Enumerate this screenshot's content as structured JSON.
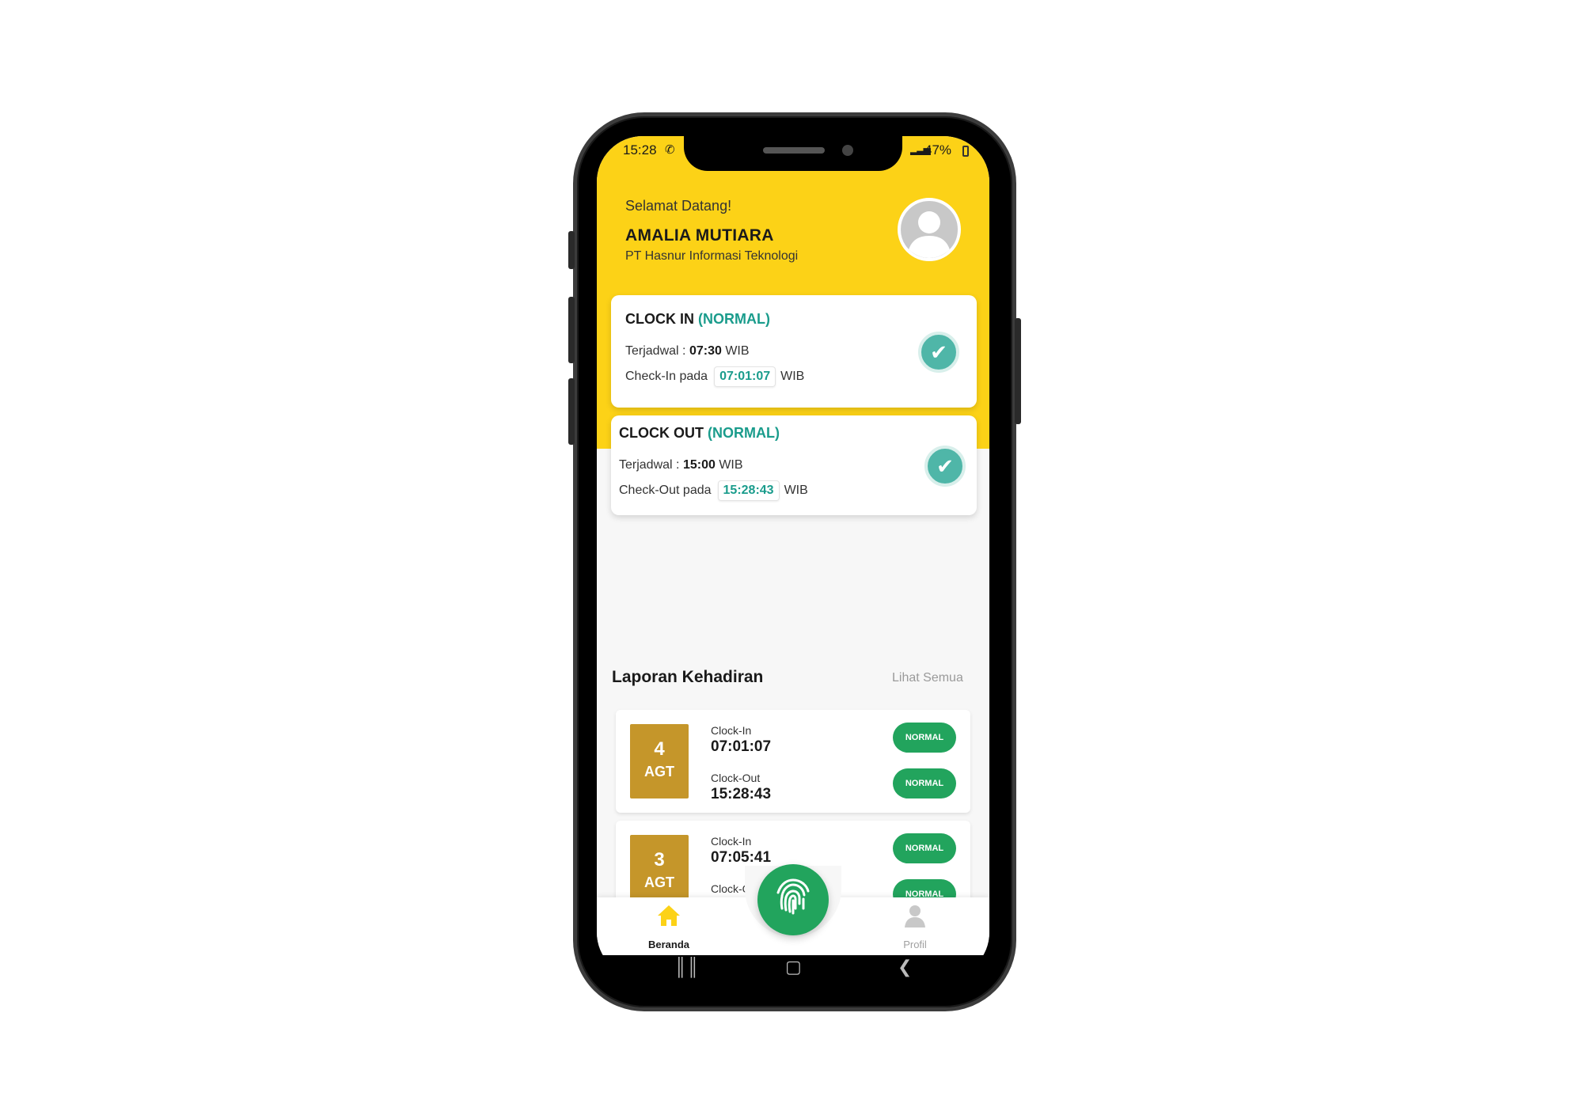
{
  "status_bar": {
    "time": "15:28",
    "battery": "47%"
  },
  "header": {
    "greeting": "Selamat Datang!",
    "user_name": "AMALIA MUTIARA",
    "company": "PT Hasnur Informasi Teknologi"
  },
  "clock_in": {
    "title": "CLOCK IN",
    "status": "(NORMAL)",
    "scheduled_label": "Terjadwal :",
    "scheduled_time": "07:30",
    "tz": "WIB",
    "actual_label": "Check-In pada",
    "actual_time": "07:01:07"
  },
  "clock_out": {
    "title": "CLOCK OUT",
    "status": "(NORMAL)",
    "scheduled_label": "Terjadwal :",
    "scheduled_time": "15:00",
    "tz": "WIB",
    "actual_label": "Check-Out pada",
    "actual_time": "15:28:43"
  },
  "report": {
    "title": "Laporan Kehadiran",
    "see_all": "Lihat Semua",
    "items": [
      {
        "day": "4",
        "month": "AGT",
        "in_label": "Clock-In",
        "in_time": "07:01:07",
        "in_status": "NORMAL",
        "out_label": "Clock-Out",
        "out_time": "15:28:43",
        "out_status": "NORMAL"
      },
      {
        "day": "3",
        "month": "AGT",
        "in_label": "Clock-In",
        "in_time": "07:05:41",
        "in_status": "NORMAL",
        "out_label": "Clock-Out",
        "out_status": "NORMAL"
      }
    ]
  },
  "nav": {
    "home_label": "Beranda",
    "profile_label": "Profil"
  },
  "colors": {
    "brand_yellow": "#fcd217",
    "accent_green": "#22a45d",
    "teal": "#1a9c8c",
    "date_gold": "#c5962a"
  }
}
